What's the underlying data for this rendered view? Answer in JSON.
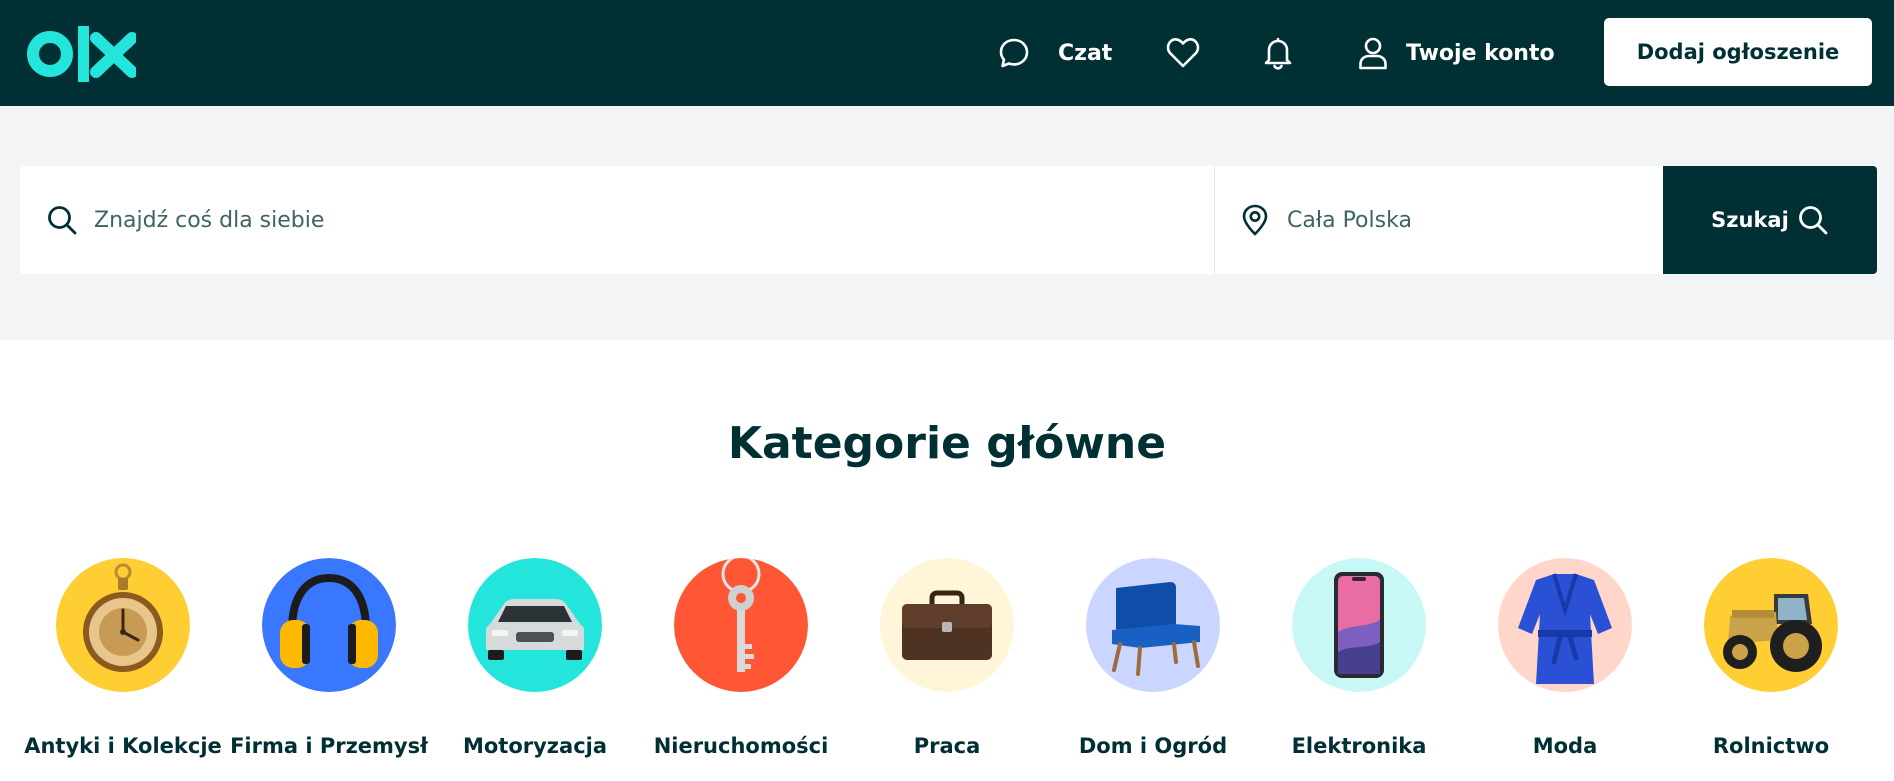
{
  "colors": {
    "brand_dark": "#002f34",
    "brand_accent": "#23e5db",
    "background_band": "#f2f4f5",
    "white": "#ffffff"
  },
  "header": {
    "logo": "olx",
    "nav": {
      "chat_label": "Czat",
      "chat_icon": "chat-bubble-icon",
      "favorites_icon": "heart-icon",
      "notifications_icon": "bell-icon",
      "account_label": "Twoje konto",
      "account_icon": "user-icon"
    },
    "add_button_label": "Dodaj ogłoszenie"
  },
  "search": {
    "query_placeholder": "Znajdź coś dla siebie",
    "query_value": "",
    "location_placeholder": "Cała Polska",
    "location_value": "",
    "button_label": "Szukaj",
    "search_icon": "search-icon",
    "location_icon": "map-pin-icon"
  },
  "main": {
    "title": "Kategorie główne",
    "categories": [
      {
        "label": "Antyki i Kolekcje",
        "icon": "pocket-watch-icon",
        "bg": "#ffce32"
      },
      {
        "label": "Firma i Przemysł",
        "icon": "ear-protectors-icon",
        "bg": "#3a77ff"
      },
      {
        "label": "Motoryzacja",
        "icon": "car-icon",
        "bg": "#23e5db"
      },
      {
        "label": "Nieruchomości",
        "icon": "key-icon",
        "bg": "#ff5636"
      },
      {
        "label": "Praca",
        "icon": "briefcase-icon",
        "bg": "#fff6d9"
      },
      {
        "label": "Dom i Ogród",
        "icon": "armchair-icon",
        "bg": "#cad6ff"
      },
      {
        "label": "Elektronika",
        "icon": "smartphone-icon",
        "bg": "#c8f8f6"
      },
      {
        "label": "Moda",
        "icon": "robe-icon",
        "bg": "#ffd6c9"
      },
      {
        "label": "Rolnictwo",
        "icon": "tractor-icon",
        "bg": "#ffce32"
      }
    ]
  }
}
